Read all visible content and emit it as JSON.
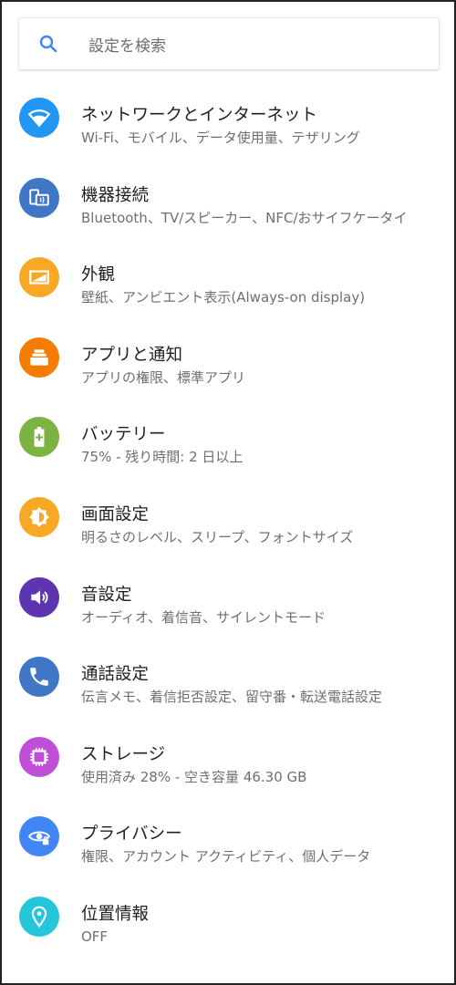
{
  "search": {
    "placeholder": "設定を検索"
  },
  "items": [
    {
      "title": "ネットワークとインターネット",
      "subtitle": "Wi-Fi、モバイル、データ使用量、テザリング",
      "icon": "wifi-icon",
      "color": "#2196f3"
    },
    {
      "title": "機器接続",
      "subtitle": "Bluetooth、TV/スピーカー、NFC/おサイフケータイ",
      "icon": "devices-icon",
      "color": "#3f76c6"
    },
    {
      "title": "外観",
      "subtitle": "壁紙、アンビエント表示(Always-on display)",
      "icon": "wallpaper-icon",
      "color": "#f9a825"
    },
    {
      "title": "アプリと通知",
      "subtitle": "アプリの権限、標準アプリ",
      "icon": "apps-icon",
      "color": "#f57c00"
    },
    {
      "title": "バッテリー",
      "subtitle": "75% - 残り時間: 2 日以上",
      "icon": "battery-icon",
      "color": "#7cb342"
    },
    {
      "title": "画面設定",
      "subtitle": "明るさのレベル、スリープ、フォントサイズ",
      "icon": "brightness-icon",
      "color": "#f9a825"
    },
    {
      "title": "音設定",
      "subtitle": "オーディオ、着信音、サイレントモード",
      "icon": "volume-icon",
      "color": "#5e35b1"
    },
    {
      "title": "通話設定",
      "subtitle": "伝言メモ、着信拒否設定、留守番・転送電話設定",
      "icon": "phone-icon",
      "color": "#3f76c6"
    },
    {
      "title": "ストレージ",
      "subtitle": "使用済み 28% - 空き容量 46.30 GB",
      "icon": "storage-icon",
      "color": "#c04fd8"
    },
    {
      "title": "プライバシー",
      "subtitle": "権限、アカウント アクティビティ、個人データ",
      "icon": "privacy-icon",
      "color": "#4285f4"
    },
    {
      "title": "位置情報",
      "subtitle": "OFF",
      "icon": "location-icon",
      "color": "#26c6da"
    }
  ]
}
